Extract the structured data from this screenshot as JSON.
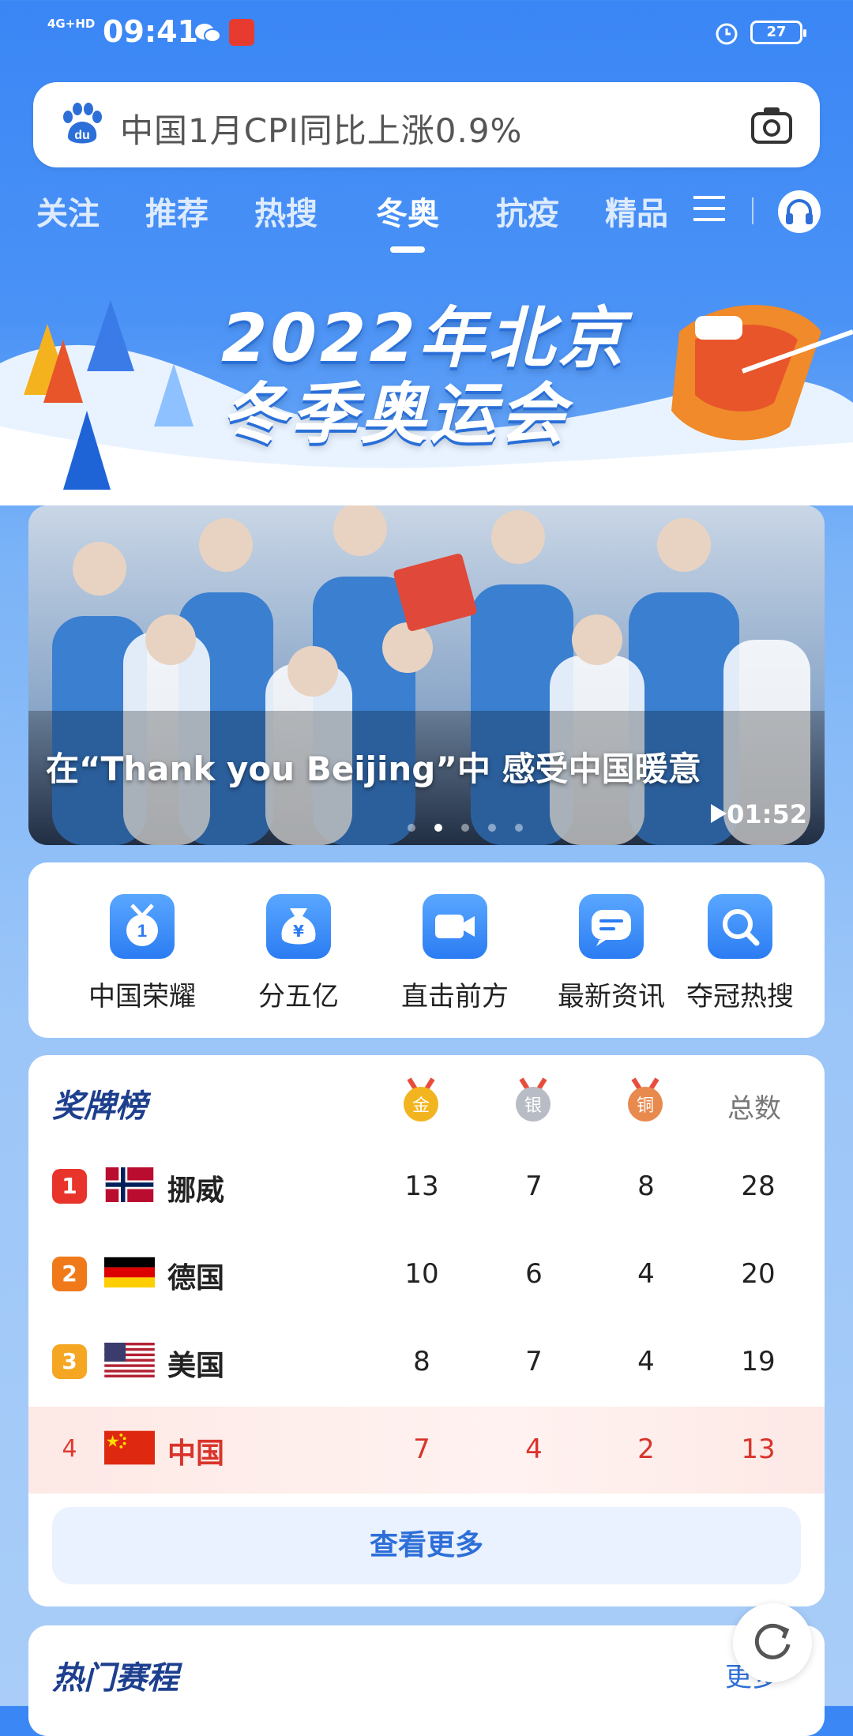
{
  "status_bar": {
    "network": "4G+HD",
    "time": "09:41",
    "battery": "27"
  },
  "search": {
    "query": "中国1月CPI同比上涨0.9%"
  },
  "tabs": [
    {
      "label": "关注"
    },
    {
      "label": "推荐"
    },
    {
      "label": "热搜"
    },
    {
      "label": "冬奥"
    },
    {
      "label": "抗疫"
    },
    {
      "label": "精品"
    }
  ],
  "banner": {
    "line1": "2022年北京",
    "line2": "冬季奥运会"
  },
  "hero": {
    "caption": "在“Thank you Beijing”中 感受中国暖意",
    "duration": "01:52"
  },
  "shortcuts": [
    {
      "label": "中国荣耀",
      "icon": "medal-icon"
    },
    {
      "label": "分五亿",
      "icon": "money-bag-icon"
    },
    {
      "label": "直击前方",
      "icon": "video-camera-icon"
    },
    {
      "label": "最新资讯",
      "icon": "message-icon"
    },
    {
      "label": "夺冠热搜",
      "icon": "search-icon"
    }
  ],
  "medal_table": {
    "title": "奖牌榜",
    "headers": {
      "gold": "金",
      "silver": "银",
      "bronze": "铜",
      "total": "总数"
    },
    "rows": [
      {
        "rank": "1",
        "country": "挪威",
        "gold": "13",
        "silver": "7",
        "bronze": "8",
        "total": "28"
      },
      {
        "rank": "2",
        "country": "德国",
        "gold": "10",
        "silver": "6",
        "bronze": "4",
        "total": "20"
      },
      {
        "rank": "3",
        "country": "美国",
        "gold": "8",
        "silver": "7",
        "bronze": "4",
        "total": "19"
      },
      {
        "rank": "4",
        "country": "中国",
        "gold": "7",
        "silver": "4",
        "bronze": "2",
        "total": "13"
      }
    ],
    "more_label": "查看更多"
  },
  "schedule": {
    "title": "热门赛程",
    "more_label": "更多"
  },
  "colors": {
    "primary": "#3a86f5",
    "accent_red": "#d8342b",
    "gold": "#f2b51f",
    "silver": "#b8bcc4",
    "bronze": "#e8894e"
  }
}
